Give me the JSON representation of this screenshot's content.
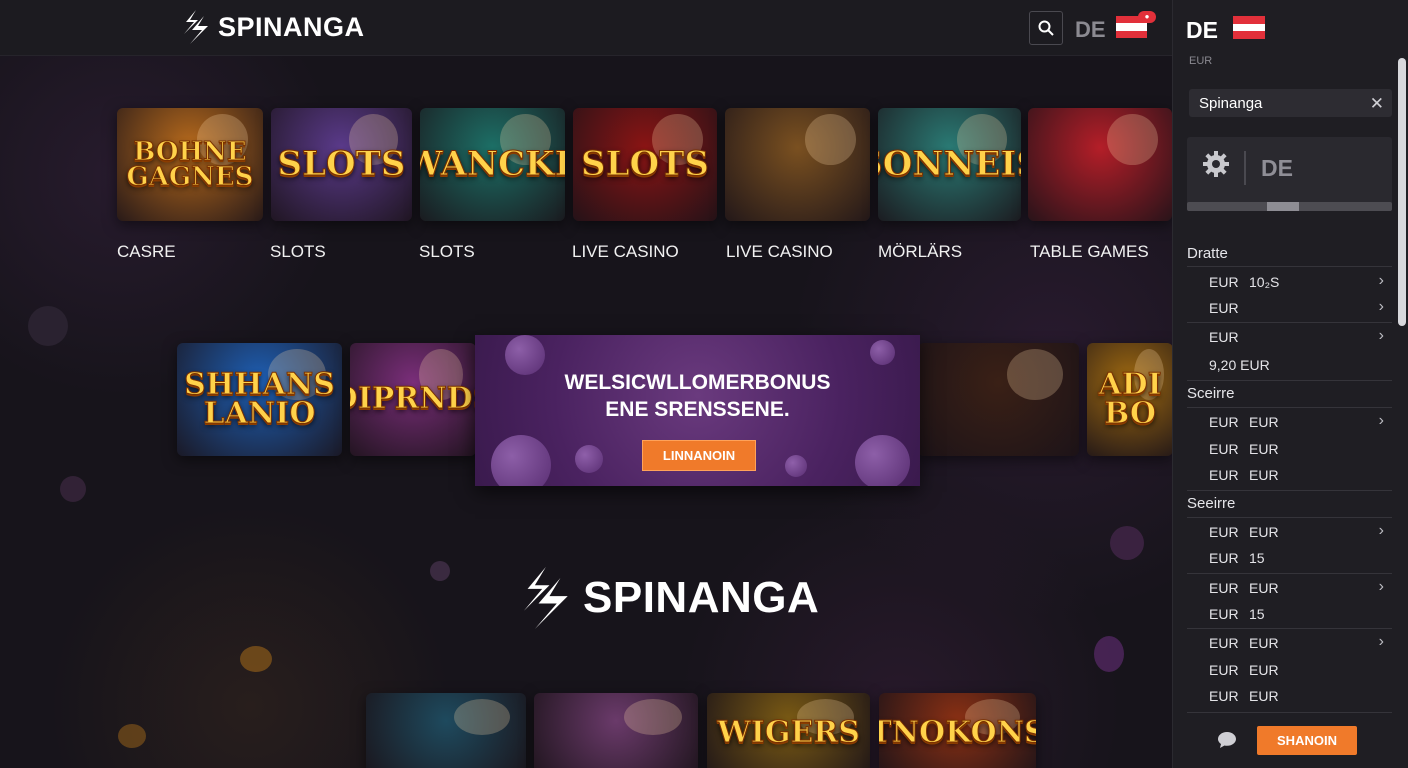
{
  "header": {
    "brand": "SPINANGA",
    "language": "DE",
    "search_icon": "search-icon",
    "flag_icon": "austria-flag-icon"
  },
  "top_row": [
    {
      "title": "BOHNE\nGAGNES",
      "label": "CASRE",
      "bg": "#b76a1c"
    },
    {
      "title": "SLOTS",
      "label": "SLOTS",
      "bg": "#5a3a8a"
    },
    {
      "title": "WANCKE",
      "label": "SLOTS",
      "bg": "#1c6f66"
    },
    {
      "title": "SLOTS",
      "label": "LIVE CASINO",
      "bg": "#8a1414"
    },
    {
      "title": "",
      "label": "LIVE CASINO",
      "bg": "#7a5020"
    },
    {
      "title": "SONNEIS",
      "label": "MÖRLÄRS",
      "bg": "#2a7a74"
    },
    {
      "title": "",
      "label": "TABLE GAMES",
      "bg": "#b41e28"
    }
  ],
  "mid_row": [
    {
      "title": "SHHANS\nLANIO",
      "bg": "#1e5fb4"
    },
    {
      "title": "DIPRNDS",
      "bg": "#7a2e7a"
    },
    {
      "title": "",
      "bg": "#3a2016"
    },
    {
      "title": "ADI\nBO",
      "bg": "#a06a10"
    }
  ],
  "promo": {
    "line1": "WELSICWLLOMERBONUS",
    "line2": "ENE SRENSSENE.",
    "button": "LINNANOIN"
  },
  "center_brand": "SPINANGA",
  "bottom_row": [
    {
      "title": "",
      "bg": "#1e4a5e"
    },
    {
      "title": "",
      "bg": "#6a3a6a"
    },
    {
      "title": "WIGERS",
      "bg": "#7a5a14"
    },
    {
      "title": "TNOKONS",
      "bg": "#8a3014"
    }
  ],
  "panel": {
    "language": "DE",
    "currency_caption": "EUR",
    "search_value": "Spinanga",
    "close_icon": "close-icon",
    "settings_language": "DE",
    "gear_icon": "gear-icon",
    "section1": "Dratte",
    "rows1": [
      {
        "a": "EUR",
        "b": "10₂S",
        "chevron": true
      },
      {
        "a": "EUR",
        "b": "",
        "chevron": true
      },
      {
        "a": "EUR",
        "b": "",
        "chevron": true
      },
      {
        "a": "9,20 EUR",
        "b": "",
        "chevron": false
      }
    ],
    "section2": "Sceirre",
    "rows2": [
      {
        "a": "EUR",
        "b": "EUR",
        "chevron": true
      },
      {
        "a": "EUR",
        "b": "EUR",
        "chevron": false
      },
      {
        "a": "EUR",
        "b": "EUR",
        "chevron": false
      }
    ],
    "section3": "Seeirre",
    "rows3": [
      {
        "a": "EUR",
        "b": "EUR",
        "chevron": true
      },
      {
        "a": "EUR",
        "b": "15",
        "chevron": false
      },
      {
        "a": "EUR",
        "b": "EUR",
        "chevron": true
      },
      {
        "a": "EUR",
        "b": "15",
        "chevron": false
      },
      {
        "a": "EUR",
        "b": "EUR",
        "chevron": true
      },
      {
        "a": "EUR",
        "b": "EUR",
        "chevron": false
      },
      {
        "a": "EUR",
        "b": "EUR",
        "chevron": false
      }
    ],
    "chat_icon": "chat-bubble-icon",
    "cta": "SHANOIN"
  },
  "colors": {
    "accent": "#f07a2a",
    "panel_bg": "#1f1e23",
    "page_bg": "#141218"
  }
}
